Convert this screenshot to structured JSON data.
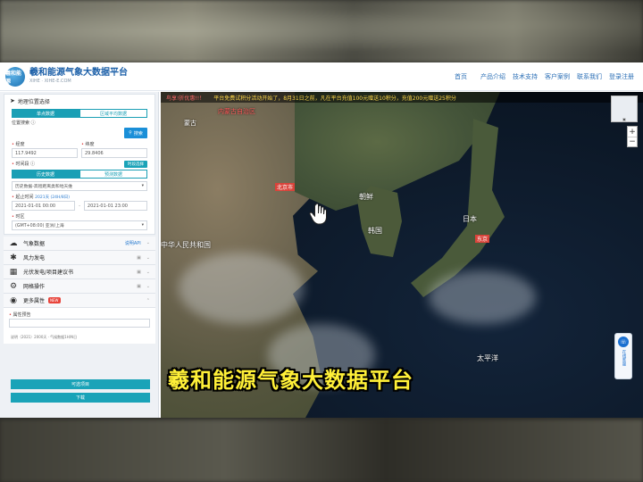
{
  "header": {
    "logo_text": "羲和能源",
    "brand_title": "羲和能源气象大数据平台",
    "brand_sub": "XIHE · XIHE-E.COM",
    "nav": [
      "首页",
      "产品介绍",
      "技术支持",
      "客户案例",
      "联系我们",
      "登录注册"
    ]
  },
  "panel": {
    "section_title": "地理位置选择",
    "tabs": [
      "单点数据",
      "区域平均数据"
    ],
    "location_label": "位置搜索",
    "search_btn": "搜索",
    "lat_label": "经度",
    "lat_value": "117.9492",
    "lon_label": "纬度",
    "lon_value": "29.8406",
    "time_label": "时间段",
    "time_btn": "时段选择",
    "time_tabs": [
      "历史数据",
      "预测数据"
    ],
    "dataset_value": "历史数据-高程距离类和地天维",
    "range_label": "起止时间",
    "range_hint": "2021天  (24H/8日)",
    "start_date": "2021-01-01 00:00",
    "end_date": "2021-01-01 23:00",
    "tz_label": "时区",
    "tz_value": "(GMT+08:00) 亚洲/上海",
    "acc": [
      {
        "title": "气象数据",
        "right": "说明API",
        "icon": "cloud-icon"
      },
      {
        "title": "风力发电",
        "right": "",
        "icon": "wind-turbine-icon"
      },
      {
        "title": "光伏发电/项目建议书",
        "right": "",
        "icon": "solar-panel-icon"
      },
      {
        "title": "网格操作",
        "right": "",
        "icon": "globe-icon"
      },
      {
        "title": "更多属性",
        "right": "",
        "icon": "more-icon",
        "badge": "NEW"
      }
    ],
    "attr_label": "属性预告",
    "bottom_note": "说明（2021）2000天 · 气候数据1H/N日",
    "btn1": "可选项目",
    "btn2": "下载"
  },
  "map": {
    "notice_1": "鸟享!折优惠!!！",
    "notice_2": "平台免费试积分活动开始了，8月31日之前，凡在平台充值100元赠送10积分，充值200元赠送25积分",
    "labels": {
      "mongolia": "蒙古",
      "beijing": "北京市",
      "korea_n": "朝鲜",
      "korea_s": "韩国",
      "japan": "日本",
      "china": "中华人民共和国",
      "pacific": "太平洋",
      "top_red": "内蒙古自治区",
      "tokyo": "东京"
    },
    "zoom_in": "+",
    "zoom_out": "−",
    "service": "在线客服"
  },
  "overlay": {
    "subtitle": "羲和能源气象大数据平台"
  }
}
